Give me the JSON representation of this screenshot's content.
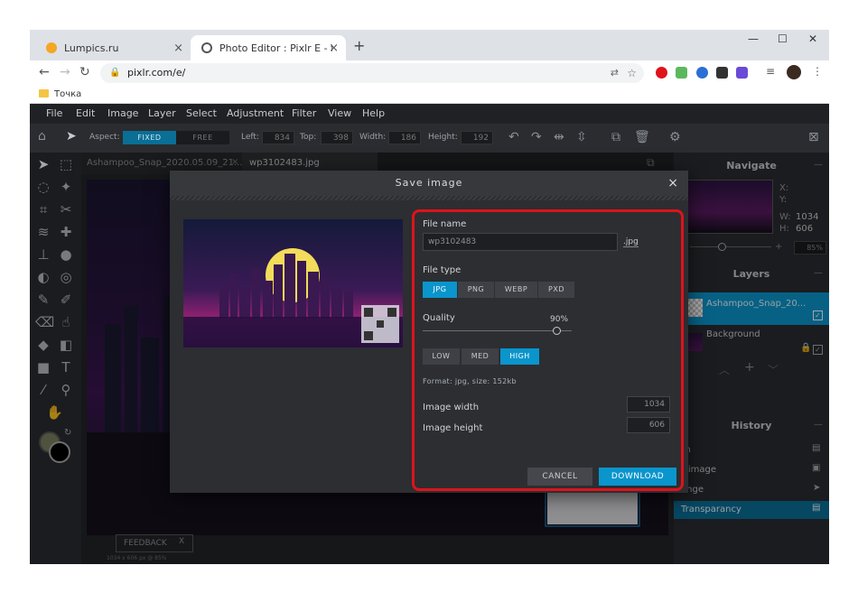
{
  "browser": {
    "tabs": [
      {
        "label": "Lumpics.ru",
        "close": "×"
      },
      {
        "label": "Photo Editor : Pixlr E - free image",
        "close": "×"
      }
    ],
    "new_tab": "+",
    "window_controls": [
      "—",
      "☐",
      "✕"
    ],
    "url": "pixlr.com/e/",
    "bookmark": "Точка"
  },
  "app": {
    "menu": [
      "File",
      "Edit",
      "Image",
      "Layer",
      "Select",
      "Adjustment",
      "Filter",
      "View",
      "Help"
    ],
    "options": {
      "aspect_label": "Aspect:",
      "fixed": "FIXED",
      "free": "FREE",
      "left_label": "Left:",
      "left_value": "834",
      "top_label": "Top:",
      "top_value": "398",
      "width_label": "Width:",
      "width_value": "186",
      "height_label": "Height:",
      "height_value": "192"
    },
    "doc_tabs": [
      "Ashampoo_Snap_2020.05.09_21...",
      "wp3102483.jpg"
    ],
    "doc_tab_close": "×",
    "status": "1034 x 606 px @ 85%",
    "feedback": {
      "label": "FEEDBACK",
      "close": "X"
    },
    "navigate": {
      "title": "Navigate",
      "x_label": "X:",
      "y_label": "Y:",
      "w_label": "W:",
      "w_value": "1034",
      "h_label": "H:",
      "h_value": "606",
      "zoom": "85%"
    },
    "layers": {
      "title": "Layers",
      "items": [
        {
          "name": "Ashampoo_Snap_20..."
        },
        {
          "name": "Background"
        }
      ]
    },
    "history": {
      "title": "History",
      "items": [
        "pen",
        "dd image",
        "rrange",
        "Transparancy"
      ]
    }
  },
  "dialog": {
    "title": "Save image",
    "close": "×",
    "file_name_label": "File name",
    "file_name_value": "wp3102483",
    "extension": ".jpg",
    "file_type_label": "File type",
    "file_types": [
      "JPG",
      "PNG",
      "WEBP",
      "PXD"
    ],
    "selected_file_type": "JPG",
    "quality_label": "Quality",
    "quality_value": "90%",
    "quality_fraction": 0.9,
    "quality_presets": [
      "LOW",
      "MED",
      "HIGH"
    ],
    "selected_preset": "HIGH",
    "format_info": "Format: jpg, size: 152kb",
    "width_label": "Image width",
    "width_value": "1034",
    "height_label": "Image height",
    "height_value": "606",
    "cancel": "CANCEL",
    "download": "DOWNLOAD"
  },
  "colors": {
    "accent": "#0a95cc",
    "highlight_border": "#e0121a",
    "foreground_swatch": "#7a8060",
    "background_swatch": "#000000"
  }
}
